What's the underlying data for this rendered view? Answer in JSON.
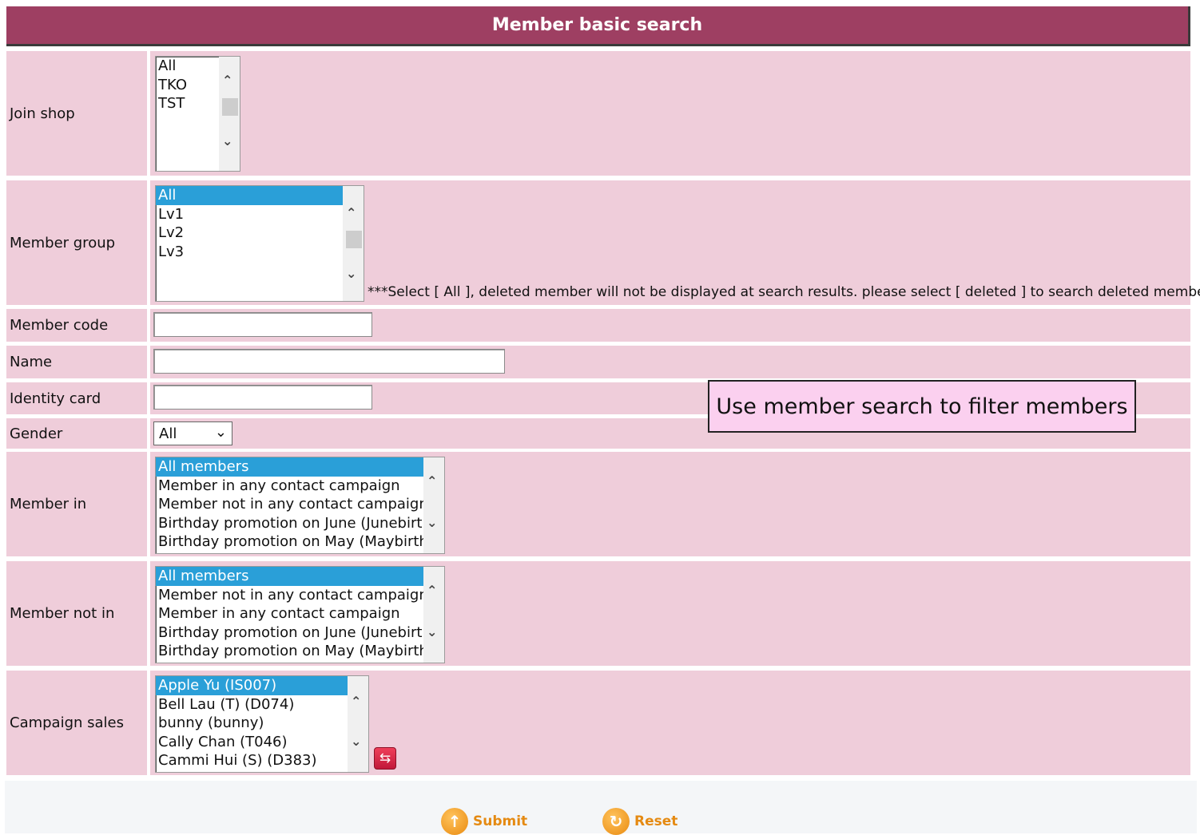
{
  "header": {
    "title": "Member basic search"
  },
  "join_shop": {
    "label": "Join shop",
    "options": [
      "All",
      "TKO",
      "TST"
    ]
  },
  "member_group": {
    "label": "Member group",
    "options": [
      "All",
      "Lv1",
      "Lv2",
      "Lv3"
    ],
    "selected": "All",
    "note": "***Select [ All ], deleted member will not be displayed at search results. please select [ deleted ] to search deleted members"
  },
  "member_code": {
    "label": "Member code",
    "value": ""
  },
  "name": {
    "label": "Name",
    "value": ""
  },
  "identity_card": {
    "label": "Identity card",
    "value": ""
  },
  "gender": {
    "label": "Gender",
    "value": "All"
  },
  "member_in": {
    "label": "Member in",
    "options": [
      "All members",
      "Member in any contact campaign",
      "Member not in any contact campaign",
      "Birthday promotion on June (Junebirth)",
      "Birthday promotion on May (Maybirth)"
    ],
    "selected": "All members"
  },
  "member_not_in": {
    "label": "Member not in",
    "options": [
      "All members",
      "Member not in any contact campaign",
      "Member in any contact campaign",
      "Birthday promotion on June (Junebirth)",
      "Birthday promotion on May (Maybirth)"
    ],
    "selected": "All members"
  },
  "campaign_sales": {
    "label": "Campaign sales",
    "options": [
      "Apple Yu (IS007)",
      "Bell Lau (T) (D074)",
      "bunny (bunny)",
      "Cally Chan (T046)",
      "Cammi Hui (S) (D383)"
    ],
    "selected": "Apple Yu (IS007)"
  },
  "callout": {
    "text": "Use member search to filter members"
  },
  "footer": {
    "submit_label": "Submit",
    "reset_label": "Reset"
  },
  "colors": {
    "header_bg": "#9e3f62",
    "row_bg": "#efcdda",
    "selection": "#2a9fd8",
    "callout_bg": "#fbd0ef",
    "button_text": "#e58a12"
  },
  "icons": {
    "scroll_up": "chevron-up-icon",
    "scroll_down": "chevron-down-icon",
    "swap": "swap-icon",
    "submit": "submit-icon",
    "reset": "reset-icon"
  }
}
